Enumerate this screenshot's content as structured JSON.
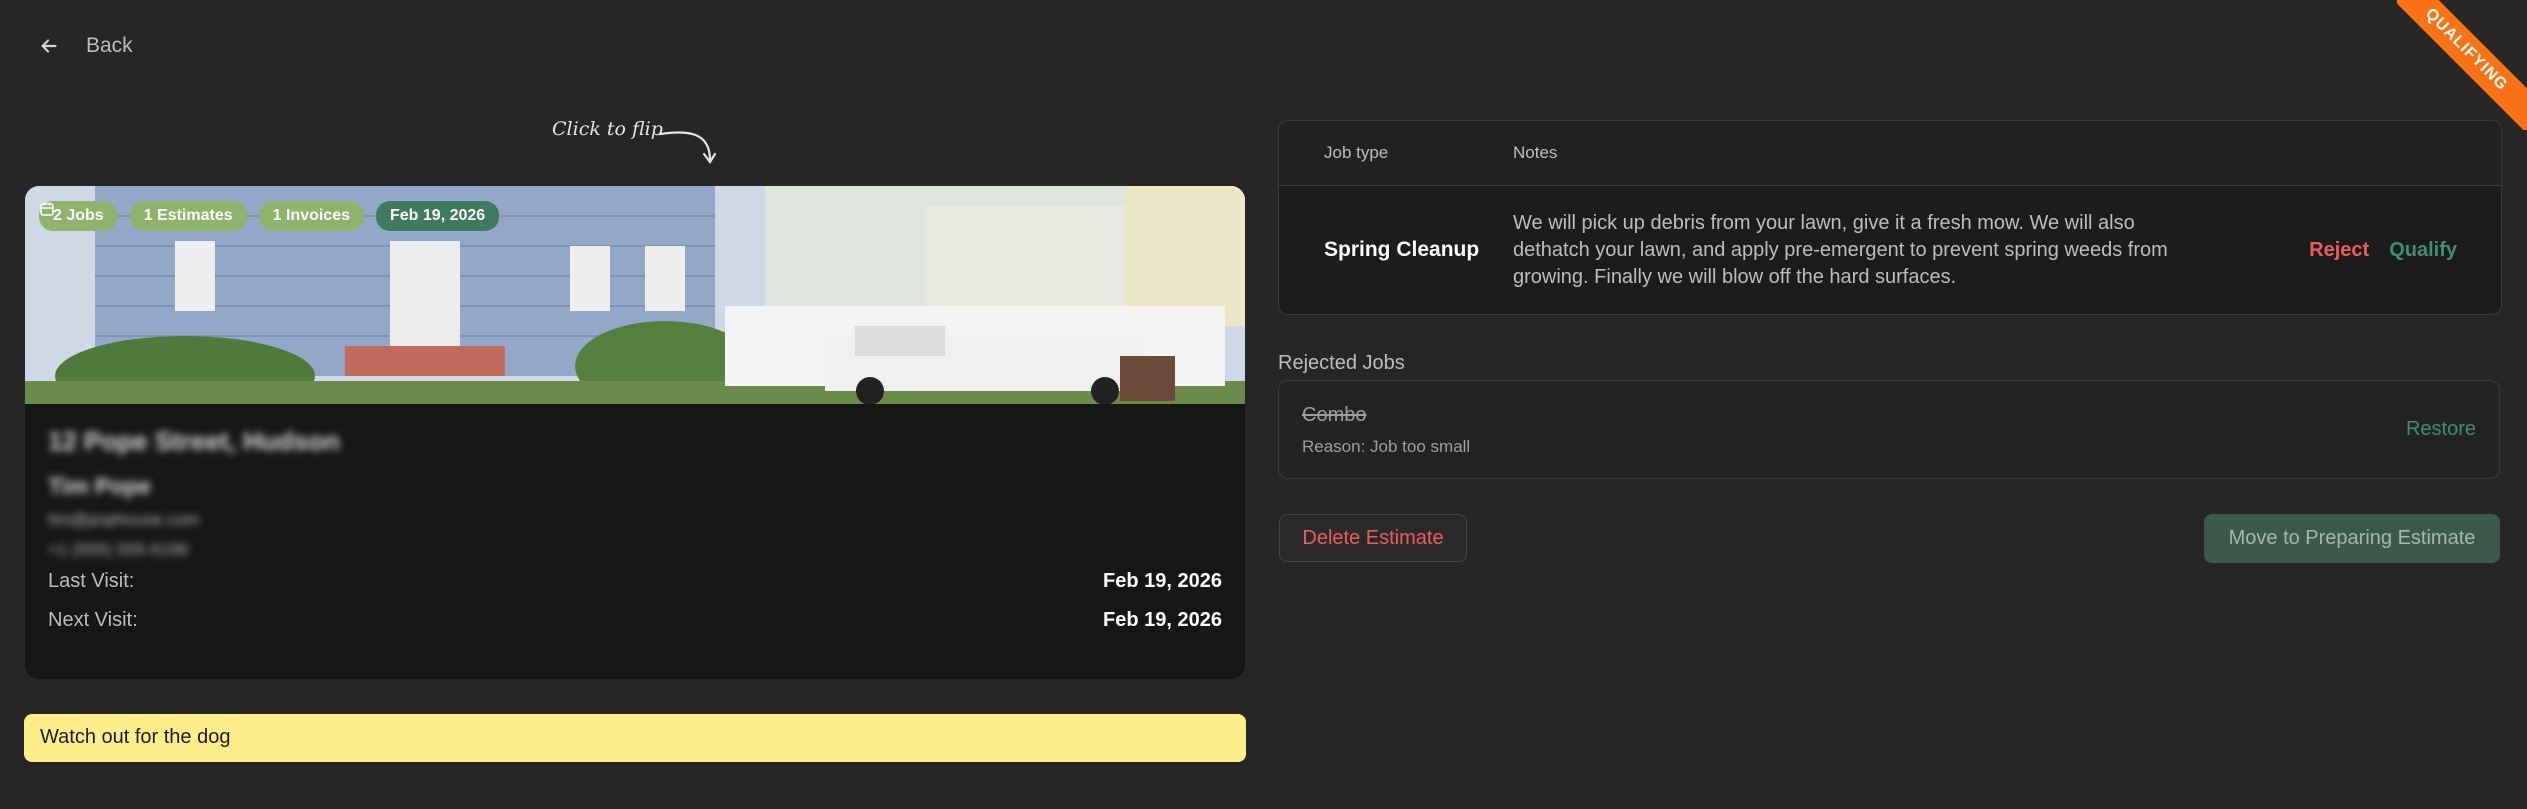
{
  "nav": {
    "back_label": "Back"
  },
  "ribbon": {
    "label": "QUALIFYING",
    "color": "#f97316"
  },
  "hint": {
    "flip_label": "Click to flip"
  },
  "card": {
    "badges": [
      {
        "label": "2 Jobs"
      },
      {
        "label": "1 Estimates"
      },
      {
        "label": "1 Invoices"
      },
      {
        "label": "Feb 19, 2026",
        "icon": "calendar-icon"
      }
    ],
    "address": "12 Pope Street, Hudson",
    "customer_name": "Tim Pope",
    "email": "tim@pophouse.com",
    "phone": "+1 (555) 555-0199",
    "last_visit_label": "Last Visit:",
    "last_visit_value": "Feb 19, 2026",
    "next_visit_label": "Next Visit:",
    "next_visit_value": "Feb 19, 2026"
  },
  "note": {
    "text": "Watch out for the dog"
  },
  "jobs_table": {
    "headers": [
      "Job type",
      "Notes"
    ],
    "rows": [
      {
        "job_type": "Spring Cleanup",
        "notes": "We will pick up debris from your lawn, give it a fresh mow. We will also dethatch your lawn, and apply pre-emergent to prevent spring weeds from growing. Finally we will blow off the hard surfaces.",
        "reject_label": "Reject",
        "qualify_label": "Qualify"
      }
    ]
  },
  "rejected": {
    "title": "Rejected Jobs",
    "items": [
      {
        "name": "Combo",
        "reason": "Reason: Job too small",
        "restore_label": "Restore"
      }
    ]
  },
  "actions": {
    "delete_label": "Delete Estimate",
    "move_label": "Move to Preparing Estimate"
  },
  "colors": {
    "accent_green": "#3f8f72",
    "danger_red": "#ef5b5b",
    "note_yellow": "#fdee8a",
    "badge_green": "#8fb36a"
  }
}
